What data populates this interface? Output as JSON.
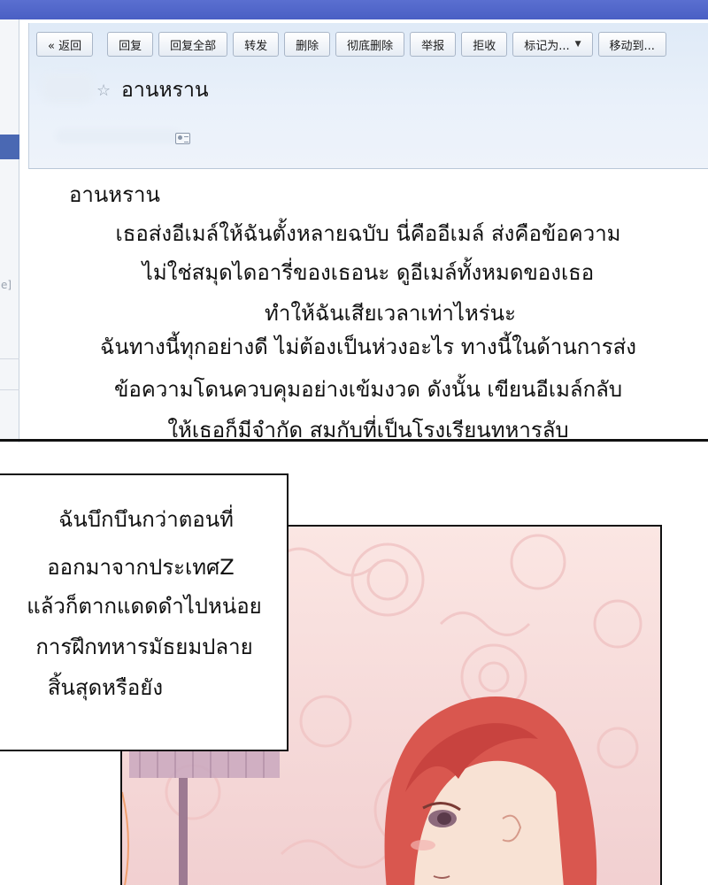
{
  "email_client": {
    "toolbar": {
      "back": "« 返回",
      "reply": "回复",
      "reply_all": "回复全部",
      "forward": "转发",
      "delete": "删除",
      "delete_permanently": "彻底删除",
      "report": "举报",
      "reject": "拒收",
      "mark_as": "标记为...",
      "move_to": "移动到..."
    },
    "subject": "อานหราน",
    "left_rail_mark": "e]"
  },
  "email_body": {
    "greeting": "อานหราน",
    "lines": [
      "เธอส่งอีเมล์ให้ฉันตั้งหลายฉบับ นี่คืออีเมล์ ส่งคือข้อความ",
      "ไม่ใช่สมุดไดอารี่ของเธอนะ ดูอีเมล์ทั้งหมดของเธอ",
      "ทำให้ฉันเสียเวลาเท่าไหร่นะ",
      "ฉันทางนี้ทุกอย่างดี ไม่ต้องเป็นห่วงอะไร ทางนี้ในด้านการส่ง",
      "ข้อความโดนควบคุมอย่างเข้มงวด ดังนั้น เขียนอีเมล์กลับ",
      "ให้เธอก็มีจำกัด สมกับที่เป็นโรงเรียนทหารลับ"
    ]
  },
  "narration_box": {
    "lines": [
      "ฉันบึกบึนกว่าตอนที่",
      "ออกมาจากประเทศZ",
      "แล้วก็ตากแดดดำไปหน่อย",
      "การฝึกทหารมัธยมปลาย",
      "สิ้นสุดหรือยัง"
    ]
  },
  "colors": {
    "title_bar": "#4a5fc4",
    "header_bg": "#e3ecf8",
    "art_bg": "#f6d8d6",
    "hair": "#d9574f",
    "skin": "#f8e2d4",
    "lamp_shade": "#c9a8be"
  },
  "icons": {
    "star": "star-icon",
    "contact_card": "contact-card-icon",
    "dropdown": "chevron-down-icon"
  }
}
